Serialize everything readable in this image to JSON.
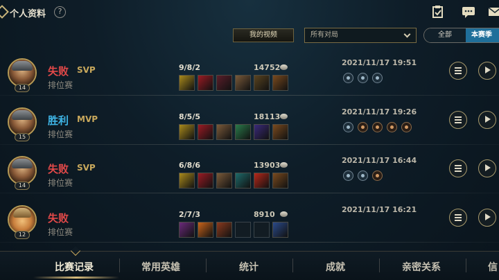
{
  "header": {
    "title": "个人资料",
    "help": "?",
    "icons": [
      "back-icon",
      "help-icon",
      "task-clipboard-icon",
      "chat-icon",
      "mail-icon"
    ]
  },
  "filters": {
    "video_button": "我的视频",
    "match_select": "所有对局",
    "segment": {
      "all": "全部",
      "season": "本赛季",
      "active": "本赛季"
    }
  },
  "colors": {
    "lose": "#e24949",
    "win": "#3fb6e7",
    "accent": "#c8a85c",
    "season_active": "#1f6f9a"
  },
  "matches": [
    {
      "result": "失败",
      "outcome": "lose",
      "badge": "SVP",
      "mode": "排位赛",
      "level": "14",
      "kda": "9/8/2",
      "gold": "14752",
      "time": "2021/11/17 19:51",
      "avatar": "champion-olaf",
      "items": [
        "#a98a1c",
        "#9a1b24",
        "#5a1e2a",
        "#7a5a3a",
        "#5a4420",
        "#7a4a1e"
      ],
      "runes": [
        "blue",
        "blue",
        "blue"
      ]
    },
    {
      "result": "胜利",
      "outcome": "win",
      "badge": "MVP",
      "mode": "排位赛",
      "level": "15",
      "kda": "8/5/5",
      "gold": "18113",
      "time": "2021/11/17 19:26",
      "avatar": "champion-olaf",
      "items": [
        "#a98a1c",
        "#9a1b24",
        "#7a5a3a",
        "#2a7a4a",
        "#3a2a7a",
        "#7a4a1e"
      ],
      "runes": [
        "blue",
        "red",
        "red",
        "red",
        "red"
      ]
    },
    {
      "result": "失败",
      "outcome": "lose",
      "badge": "SVP",
      "mode": "排位赛",
      "level": "14",
      "kda": "6/8/6",
      "gold": "13903",
      "time": "2021/11/17 16:44",
      "avatar": "champion-olaf",
      "items": [
        "#a98a1c",
        "#9a1b24",
        "#7a5a3a",
        "#1e6a6a",
        "#b8281a",
        "#7a4a1e"
      ],
      "runes": [
        "blue",
        "blue",
        "red"
      ]
    },
    {
      "result": "失败",
      "outcome": "lose",
      "badge": "",
      "mode": "排位赛",
      "level": "12",
      "kda": "2/7/3",
      "gold": "8910",
      "time": "2021/11/17 16:21",
      "avatar": "champion-teemo",
      "items": [
        "#6a2a7a",
        "#c8641a",
        "#8a3a1e",
        "",
        "",
        "#2a4a8a"
      ],
      "runes": []
    }
  ],
  "tabs": [
    "比赛记录",
    "常用英雄",
    "统计",
    "成就",
    "亲密关系",
    "信"
  ]
}
